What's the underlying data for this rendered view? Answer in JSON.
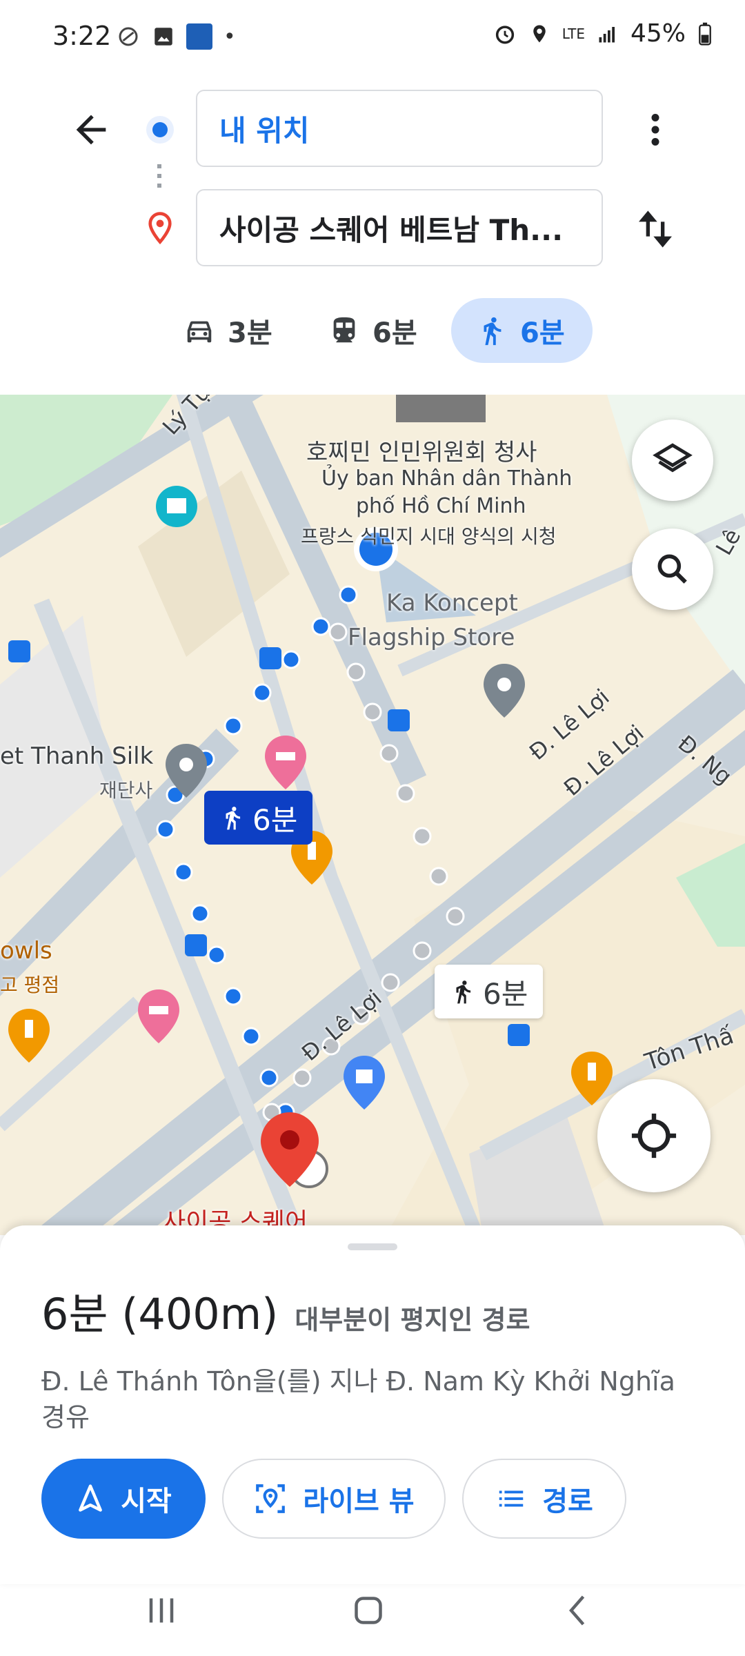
{
  "status_bar": {
    "time": "3:22",
    "battery": "45%",
    "network": "LTE"
  },
  "directions": {
    "origin": "내 위치",
    "destination": "사이공 스퀘어 베트남 Th..."
  },
  "modes": [
    {
      "icon": "car-icon",
      "label": "3분"
    },
    {
      "icon": "transit-icon",
      "label": "6분"
    },
    {
      "icon": "walk-icon",
      "label": "6분",
      "selected": true
    }
  ],
  "map": {
    "labels": {
      "city_hall_ko": "호찌민 인민위원회 청사",
      "city_hall_vi_1": "Ủy ban Nhân dân Thành",
      "city_hall_vi_2": "phố Hồ Chí Minh",
      "city_hall_desc": "프랑스 식민지 시대 양식의 시청",
      "store_1": "Ka Koncept",
      "store_2": "Flagship Store",
      "silk": "et Thanh Silk",
      "silk_sub": "재단사",
      "bowls": "owls",
      "bowls_sub": "고 평점",
      "street_ly_tu": "Lý Tự T",
      "street_le_loi_1": "Đ. Lê Lợi",
      "street_le_loi_2": "Đ. Lê Lợi",
      "street_le_loi_3": "Đ. Lê Lợi",
      "street_ng": "Đ. Ng",
      "street_le": "Lê",
      "street_ton": "Tôn Thấ",
      "destination_label": "사이공 스퀘어"
    },
    "route_badges": {
      "primary": "6분",
      "alternate": "6분"
    }
  },
  "sheet": {
    "duration": "6분 (400m)",
    "note": "대부분이 평지인 경로",
    "via": "Đ. Lê Thánh Tôn을(를) 지나 Đ. Nam Kỳ Khởi Nghĩa 경유",
    "start_label": "시작",
    "live_view_label": "라이브 뷰",
    "steps_label": "경로"
  },
  "colors": {
    "accent": "#1a73e8",
    "route_dark": "#0d4fc4",
    "route_alt": "#bdc1c6",
    "dest_pin": "#ea4335"
  }
}
